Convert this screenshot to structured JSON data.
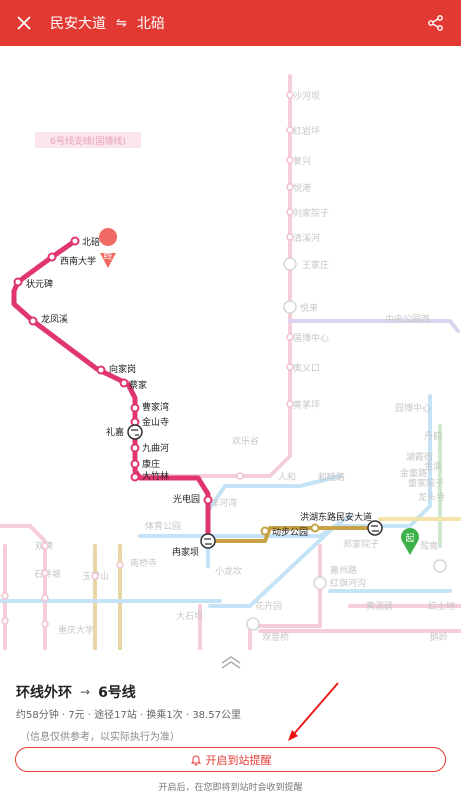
{
  "header": {
    "from_station": "民安大道",
    "swap_symbol": "⇋",
    "to_station": "北碚",
    "bg_color": "#e23a33"
  },
  "icons": {
    "close": "close-icon",
    "share": "share-icon",
    "bell": "bell-icon",
    "chevron": "chevron-up-icon",
    "transfer": "transfer-icon"
  },
  "map": {
    "line_banner": "6号线支线(国博线)",
    "end_marker": "终",
    "start_marker": "起",
    "route_stations": [
      "北碚",
      "西南大学",
      "状元碑",
      "龙凤溪",
      "向家岗",
      "蔡家",
      "曹家湾",
      "金山寺",
      "礼嘉",
      "九曲河",
      "康庄",
      "大竹林",
      "光电园",
      "冉家坝",
      "动步公园",
      "洪湖东路民安大道"
    ],
    "faded_stations": [
      "沙河坝",
      "红岩坪",
      "复兴",
      "悦港",
      "刘家院子",
      "清溪河",
      "王家庄",
      "悦来",
      "国博中心",
      "奥义口",
      "黄茅坪",
      "中央公园西",
      "欢乐谷",
      "人和",
      "和睦路",
      "洋河湾",
      "园博中心",
      "丹鹤",
      "湖霞街",
      "金渝",
      "金童路",
      "童家院子",
      "龙头寺",
      "郑家院子",
      "鸳鸯",
      "嘉州路",
      "红旗河沟",
      "黄泥磅",
      "红土地",
      "体育公园",
      "南桥寺",
      "石井坡",
      "双碑",
      "玉带山",
      "花卉园",
      "重庆大学",
      "小龙坎",
      "大石坝",
      "观音桥",
      "鹅岭",
      "高家花园",
      "嘉陵江",
      "大龙山",
      "桂花园",
      "蜂窝坝",
      "头塘"
    ],
    "colors": {
      "route": "#e0356f",
      "route_dark": "#c8305f",
      "faded_pink": "#f6cdd9",
      "faded_blue": "#c5e3f6",
      "faded_lavender": "#dcd5f0",
      "faded_green": "#cfe9cf",
      "faded_gold": "#e8d7a5",
      "gold_line": "#c8a346",
      "marker_red": "#f06a63",
      "marker_green": "#3db24a"
    }
  },
  "panel": {
    "route_from_line": "环线外环",
    "route_arrow": "→",
    "route_to_line": "6号线",
    "meta": "约58分钟 · 7元 · 途径17站 · 换乘1次 · 38.57公里",
    "note": "（信息仅供参考，以实际执行为准）",
    "remind_label": "开启到站提醒",
    "hint": "开启后，在您即将到站时会收到提醒"
  }
}
